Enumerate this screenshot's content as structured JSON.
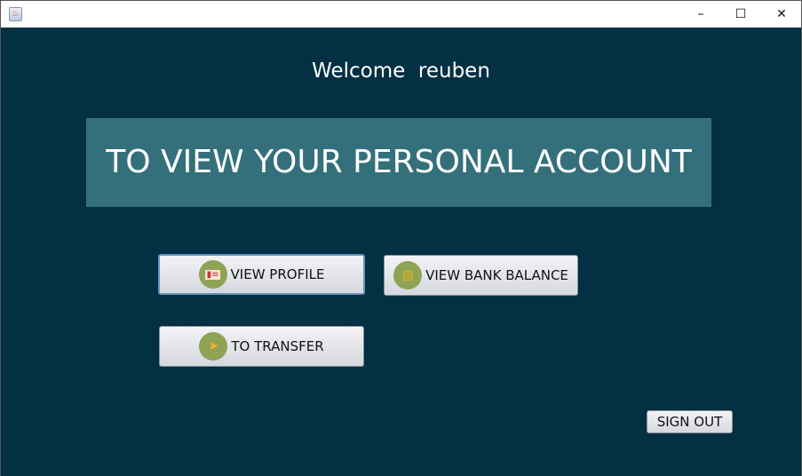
{
  "window": {
    "minimize": "–",
    "maximize": "☐",
    "close": "✕"
  },
  "welcome": {
    "label": "Welcome",
    "user": "reuben"
  },
  "banner": "TO VIEW YOUR PERSONAL ACCOUNT",
  "buttons": {
    "view_profile": "VIEW PROFILE",
    "view_bank_balance": "VIEW BANK BALANCE",
    "to_transfer": "TO TRANSFER",
    "sign_out": "SIGN OUT"
  }
}
